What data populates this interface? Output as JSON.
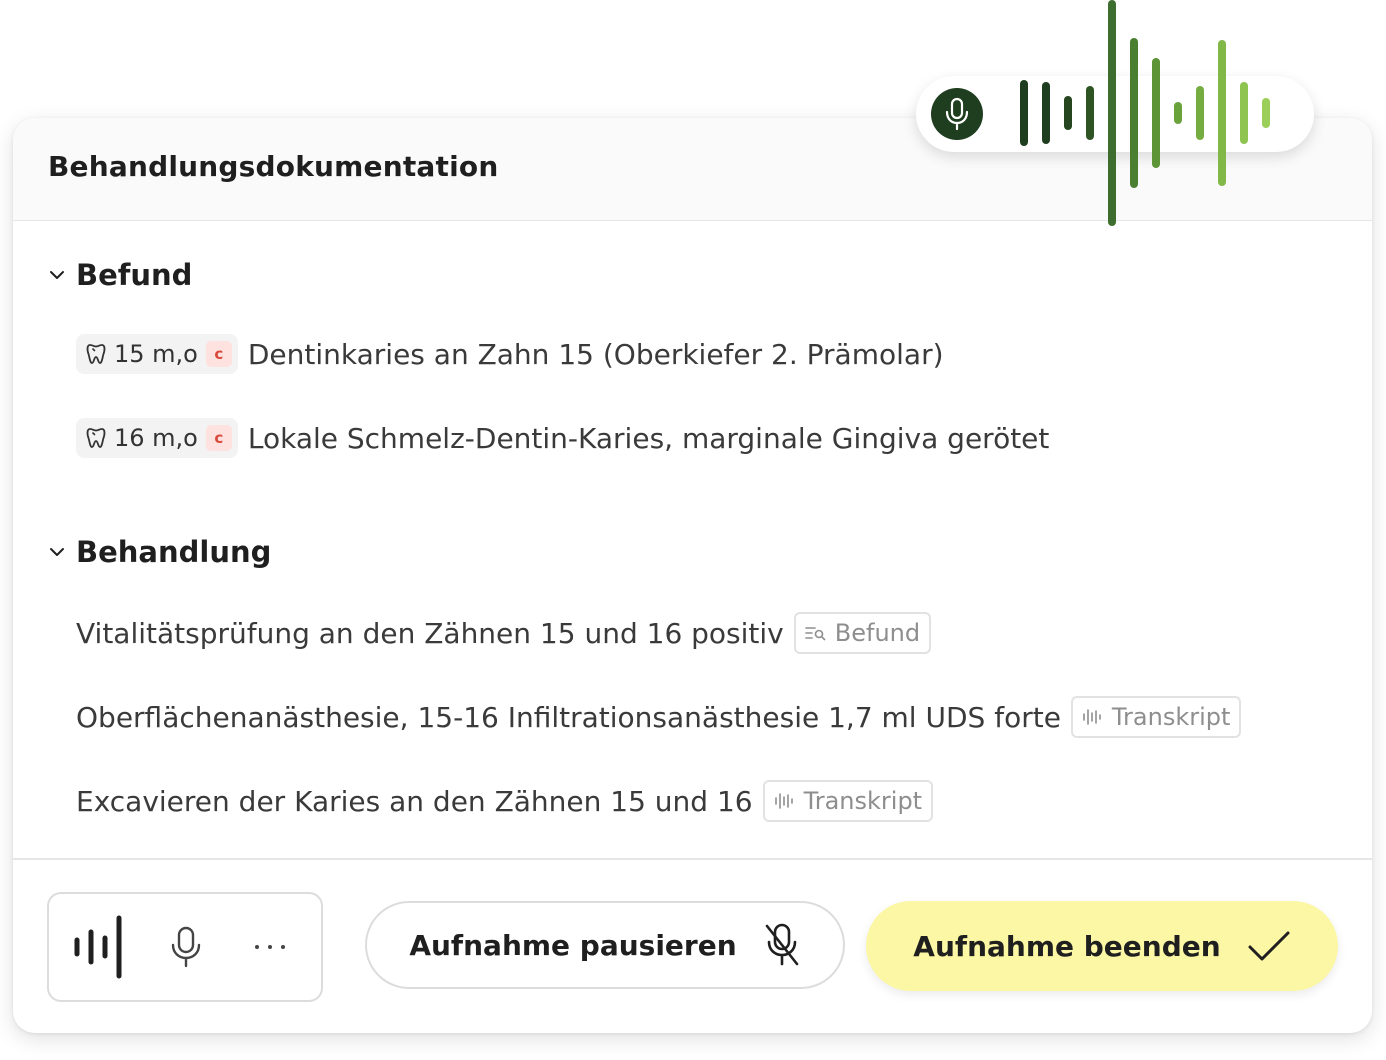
{
  "card": {
    "title": "Behandlungsdokumentation"
  },
  "befund": {
    "heading": "Befund",
    "items": [
      {
        "tooth": "15 m,o",
        "badge": "c",
        "text": "Dentinkaries an Zahn 15 (Oberkiefer 2. Prämolar)"
      },
      {
        "tooth": "16 m,o",
        "badge": "c",
        "text": "Lokale Schmelz-Dentin-Karies, marginale Gingiva gerötet"
      }
    ]
  },
  "behandlung": {
    "heading": "Behandlung",
    "items": [
      {
        "text": "Vitalitätsprüfung an den Zähnen 15 und 16 positiv",
        "source": "Befund",
        "source_icon": "search-list-icon"
      },
      {
        "text": "Oberflächenanästhesie, 15-16 Infiltrationsanästhesie 1,7 ml UDS forte",
        "source": "Transkript",
        "source_icon": "waveform-icon"
      },
      {
        "text": "Excavieren der Karies an den Zähnen 15 und 16",
        "source": "Transkript",
        "source_icon": "waveform-icon"
      }
    ]
  },
  "controls": {
    "pause_label": "Aufnahme pausieren",
    "end_label": "Aufnahme beenden"
  },
  "colors": {
    "accent_dark": "#1f3d1f",
    "end_button": "#fbf7a4",
    "badge_bg": "#fde2df",
    "badge_text": "#d8493b",
    "wave_colors": [
      "#1f3d1f",
      "#3d6e2f",
      "#5d9436",
      "#7fb345",
      "#9ccf59"
    ]
  }
}
